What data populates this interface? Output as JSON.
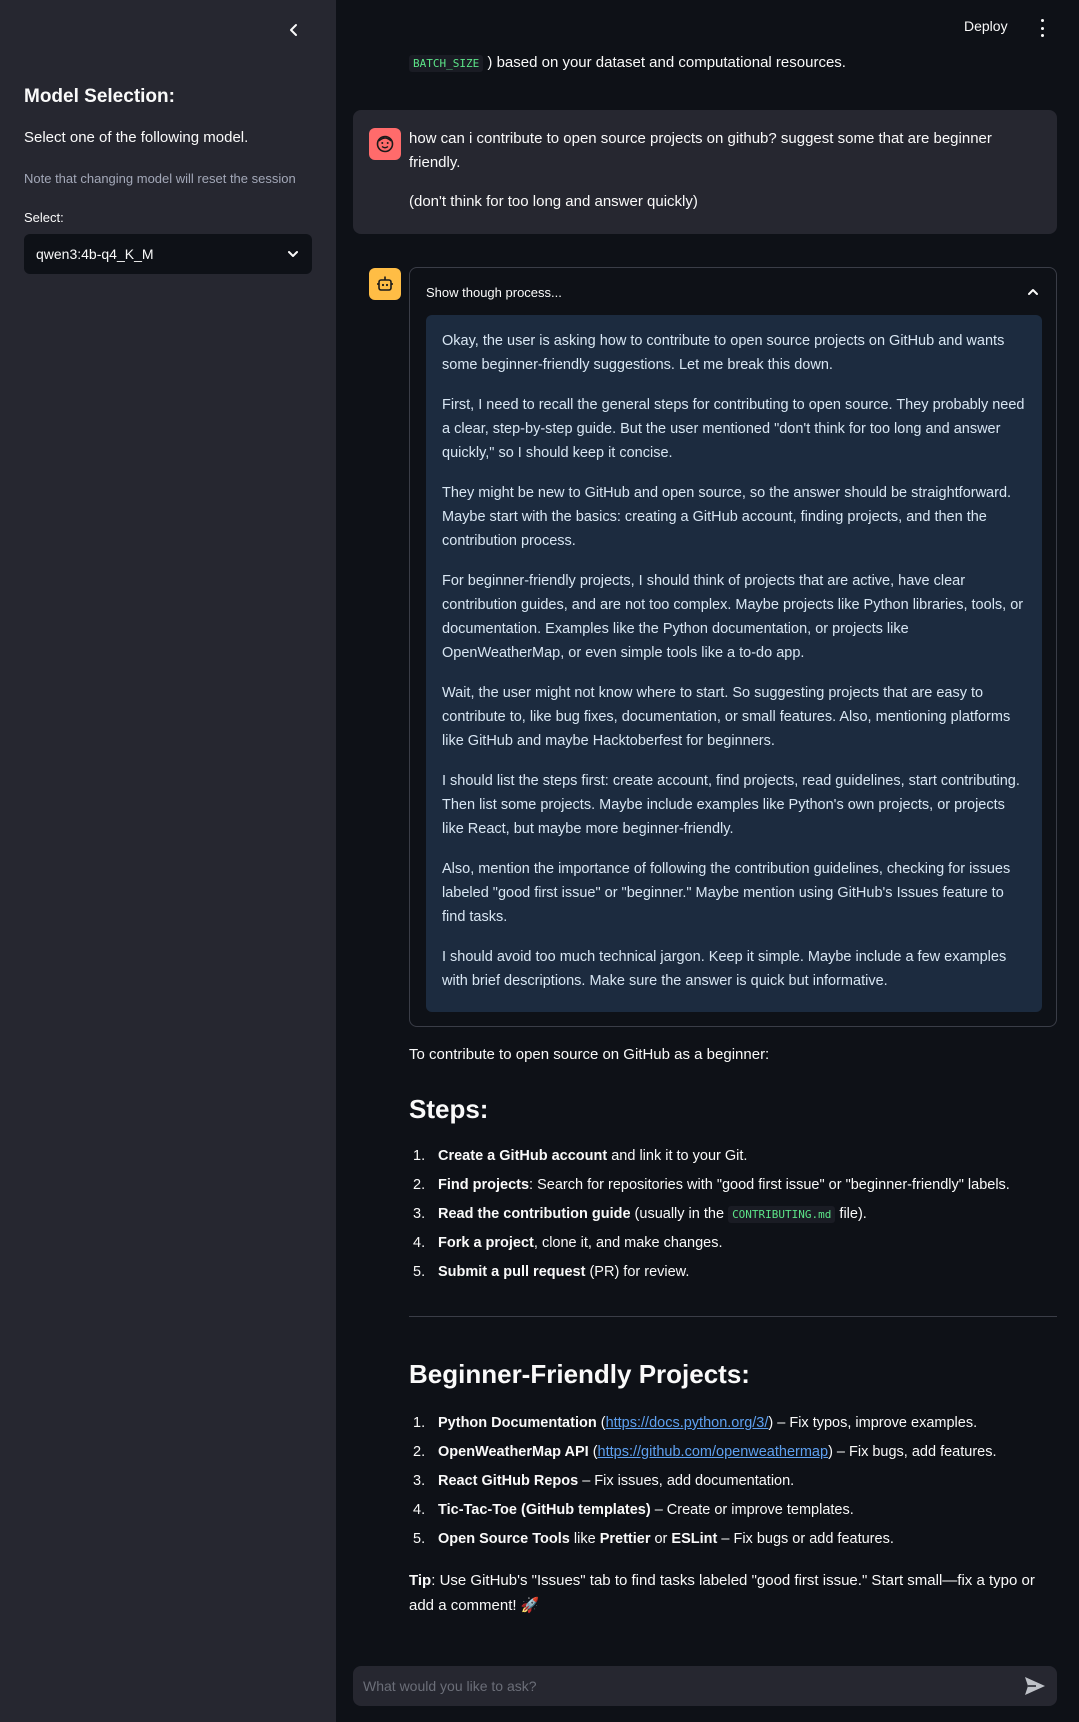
{
  "header": {
    "deploy_label": "Deploy"
  },
  "sidebar": {
    "title": "Model Selection:",
    "subtitle": "Select one of the following model.",
    "note": "Note that changing model will reset the session",
    "select_label": "Select:",
    "select_value": "qwen3:4b-q4_K_M"
  },
  "chat": {
    "prev_tail_code": "BATCH_SIZE",
    "prev_tail_text": ") based on your dataset and computational resources.",
    "user_message": {
      "line1": "how can i contribute to open source projects on github? suggest some that are beginner friendly.",
      "line2": "(don't think for too long and answer quickly)"
    },
    "thought_toggle_label": "Show though process...",
    "thought_paragraphs": [
      "Okay, the user is asking how to contribute to open source projects on GitHub and wants some beginner-friendly suggestions. Let me break this down.",
      "First, I need to recall the general steps for contributing to open source. They probably need a clear, step-by-step guide. But the user mentioned \"don't think for too long and answer quickly,\" so I should keep it concise.",
      "They might be new to GitHub and open source, so the answer should be straightforward. Maybe start with the basics: creating a GitHub account, finding projects, and then the contribution process.",
      "For beginner-friendly projects, I should think of projects that are active, have clear contribution guides, and are not too complex. Maybe projects like Python libraries, tools, or documentation. Examples like the Python documentation, or projects like OpenWeatherMap, or even simple tools like a to-do app.",
      "Wait, the user might not know where to start. So suggesting projects that are easy to contribute to, like bug fixes, documentation, or small features. Also, mentioning platforms like GitHub and maybe Hacktoberfest for beginners.",
      "I should list the steps first: create account, find projects, read guidelines, start contributing. Then list some projects. Maybe include examples like Python's own projects, or projects like React, but maybe more beginner-friendly.",
      "Also, mention the importance of following the contribution guidelines, checking for issues labeled \"good first issue\" or \"beginner.\" Maybe mention using GitHub's Issues feature to find tasks.",
      "I should avoid too much technical jargon. Keep it simple. Maybe include a few examples with brief descriptions. Make sure the answer is quick but informative."
    ],
    "answer": {
      "intro": "To contribute to open source on GitHub as a beginner:",
      "steps_heading": "Steps:",
      "steps": [
        {
          "num": "1.",
          "bold": "Create a GitHub account",
          "rest": " and link it to your Git."
        },
        {
          "num": "2.",
          "bold": "Find projects",
          "rest": ": Search for repositories with \"good first issue\" or \"beginner-friendly\" labels."
        },
        {
          "num": "3.",
          "bold": "Read the contribution guide",
          "rest_pre": " (usually in the ",
          "code": "CONTRIBUTING.md",
          "rest_post": " file)."
        },
        {
          "num": "4.",
          "bold": "Fork a project",
          "rest": ", clone it, and make changes."
        },
        {
          "num": "5.",
          "bold": "Submit a pull request",
          "rest": " (PR) for review."
        }
      ],
      "projects_heading": "Beginner-Friendly Projects:",
      "projects": [
        {
          "num": "1.",
          "bold": "Python Documentation",
          "pre": " (",
          "link": "https://docs.python.org/3/",
          "post": ") – Fix typos, improve examples."
        },
        {
          "num": "2.",
          "bold": "OpenWeatherMap API",
          "pre": " (",
          "link": "https://github.com/openweathermap",
          "post": ") – Fix bugs, add features."
        },
        {
          "num": "3.",
          "bold": "React GitHub Repos",
          "rest": " – Fix issues, add documentation."
        },
        {
          "num": "4.",
          "bold": "Tic-Tac-Toe (GitHub templates)",
          "rest": " – Create or improve templates."
        },
        {
          "num": "5.",
          "bold": "Open Source Tools",
          "mid": " like ",
          "bold2": "Prettier",
          "mid2": " or ",
          "bold3": "ESLint",
          "rest": " – Fix bugs or add features."
        }
      ],
      "tip_bold": "Tip",
      "tip_text": ": Use GitHub's \"Issues\" tab to find tasks labeled \"good first issue.\" Start small—fix a typo or add a comment! 🚀"
    },
    "input_placeholder": "What would you like to ask?"
  },
  "colors": {
    "user_avatar": "#ff6b6b",
    "bot_avatar": "#ffbd45",
    "link": "#5ea0f0",
    "code": "#5ce488"
  }
}
